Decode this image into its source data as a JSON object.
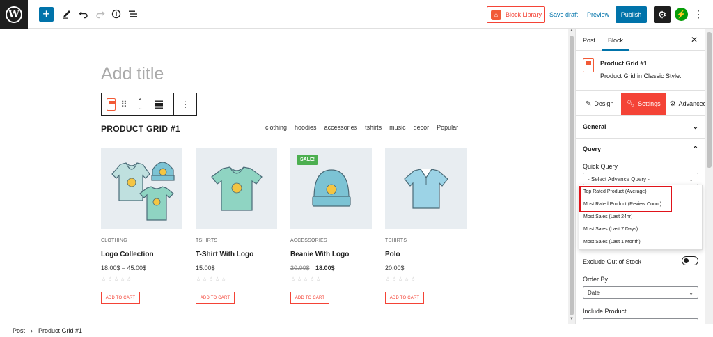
{
  "topbar": {
    "block_library_label": "Block Library",
    "save_draft_label": "Save draft",
    "preview_label": "Preview",
    "publish_label": "Publish",
    "add_label": "+",
    "jetpack_label": "⚡",
    "more_label": "⋮",
    "icons": [
      "wordpress-logo-icon",
      "plus-icon",
      "pen-icon",
      "undo-icon",
      "redo-icon",
      "info-icon",
      "list-view-icon",
      "gear-icon",
      "jetpack-icon",
      "more-vertical-icon"
    ],
    "accent_color": "#0073aa",
    "brand_color": "#f44336"
  },
  "editor": {
    "title_placeholder": "Add title",
    "block_heading": "PRODUCT GRID #1",
    "filters": [
      "clothing",
      "hoodies",
      "accessories",
      "tshirts",
      "music",
      "decor",
      "Popular"
    ],
    "products": [
      {
        "category": "CLOTHING",
        "name": "Logo Collection",
        "price": "18.00$ – 45.00$",
        "old_price": "",
        "sale": "",
        "stars": "☆☆☆☆☆",
        "button": "ADD TO CART"
      },
      {
        "category": "TSHIRTS",
        "name": "T-Shirt With Logo",
        "price": "15.00$",
        "old_price": "",
        "sale": "",
        "stars": "☆☆☆☆☆",
        "button": "ADD TO CART"
      },
      {
        "category": "ACCESSORIES",
        "name": "Beanie With Logo",
        "price": "18.00$",
        "old_price": "20.00$",
        "sale": "SALE!",
        "stars": "☆☆☆☆☆",
        "button": "ADD TO CART"
      },
      {
        "category": "TSHIRTS",
        "name": "Polo",
        "price": "20.00$",
        "old_price": "",
        "sale": "",
        "stars": "☆☆☆☆☆",
        "button": "ADD TO CART"
      }
    ]
  },
  "breadcrumb": {
    "root": "Post",
    "separator": "›",
    "current": "Product Grid #1"
  },
  "sidebar": {
    "tab_post": "Post",
    "tab_block": "Block",
    "close_label": "✕",
    "block_title": "Product Grid #1",
    "block_desc": "Product Grid in Classic Style.",
    "sub_tabs": {
      "design": "Design",
      "settings": "Settings",
      "advanced": "Advanced"
    },
    "general_label": "General",
    "query_label": "Query",
    "quick_query_label": "Quick Query",
    "quick_query_value": "- Select Advance Query -",
    "exclude_label": "Exclude Out of Stock",
    "order_by_label": "Order By",
    "order_by_value": "Date",
    "include_product_label": "Include Product",
    "chevron_down": "⌄",
    "chevron_up": "⌃"
  },
  "dropdown": {
    "items": [
      "Top Rated Product (Average)",
      "Most Rated Product (Review Count)",
      "Most Sales (Last 24hr)",
      "Most Sales (Last 7 Days)",
      "Most Sales (Last 1 Month)"
    ],
    "highlight_color": "#e0131a"
  }
}
